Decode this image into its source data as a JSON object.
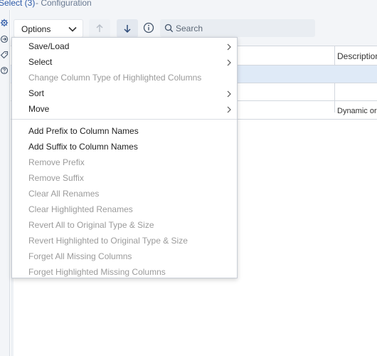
{
  "window": {
    "title": "Select (3)",
    "subtitle": "- Configuration"
  },
  "toolbar": {
    "options_label": "Options",
    "search_placeholder": "Search"
  },
  "grid": {
    "header_description": "Description",
    "row3_description": "Dynamic or"
  },
  "menu": {
    "items": [
      {
        "label": "Save/Load",
        "enabled": true,
        "submenu": true
      },
      {
        "label": "Select",
        "enabled": true,
        "submenu": true
      },
      {
        "label": "Change Column Type of Highlighted Columns",
        "enabled": false,
        "submenu": false
      },
      {
        "label": "Sort",
        "enabled": true,
        "submenu": true
      },
      {
        "label": "Move",
        "enabled": true,
        "submenu": true
      },
      {
        "label": "Add Prefix to Column Names",
        "enabled": true,
        "submenu": false
      },
      {
        "label": "Add Suffix to Column Names",
        "enabled": true,
        "submenu": false
      },
      {
        "label": "Remove Prefix",
        "enabled": false,
        "submenu": false
      },
      {
        "label": "Remove Suffix",
        "enabled": false,
        "submenu": false
      },
      {
        "label": "Clear All Renames",
        "enabled": false,
        "submenu": false
      },
      {
        "label": "Clear Highlighted Renames",
        "enabled": false,
        "submenu": false
      },
      {
        "label": "Revert All to Original Type & Size",
        "enabled": false,
        "submenu": false
      },
      {
        "label": "Revert Highlighted to Original Type & Size",
        "enabled": false,
        "submenu": false
      },
      {
        "label": "Forget All Missing Columns",
        "enabled": false,
        "submenu": false
      },
      {
        "label": "Forget Highlighted Missing Columns",
        "enabled": false,
        "submenu": false
      }
    ]
  },
  "icons": {
    "rail": [
      "gear-icon",
      "link-icon",
      "tag-icon",
      "help-icon"
    ],
    "toolbar": [
      "chevron-down-icon",
      "arrow-up-icon",
      "arrow-down-icon",
      "info-icon",
      "search-icon"
    ],
    "menu": [
      "chevron-right-icon"
    ]
  },
  "colors": {
    "accent": "#2d5aa8",
    "selected_row": "#dfeaf7",
    "disabled_text": "#9b9b9b"
  }
}
